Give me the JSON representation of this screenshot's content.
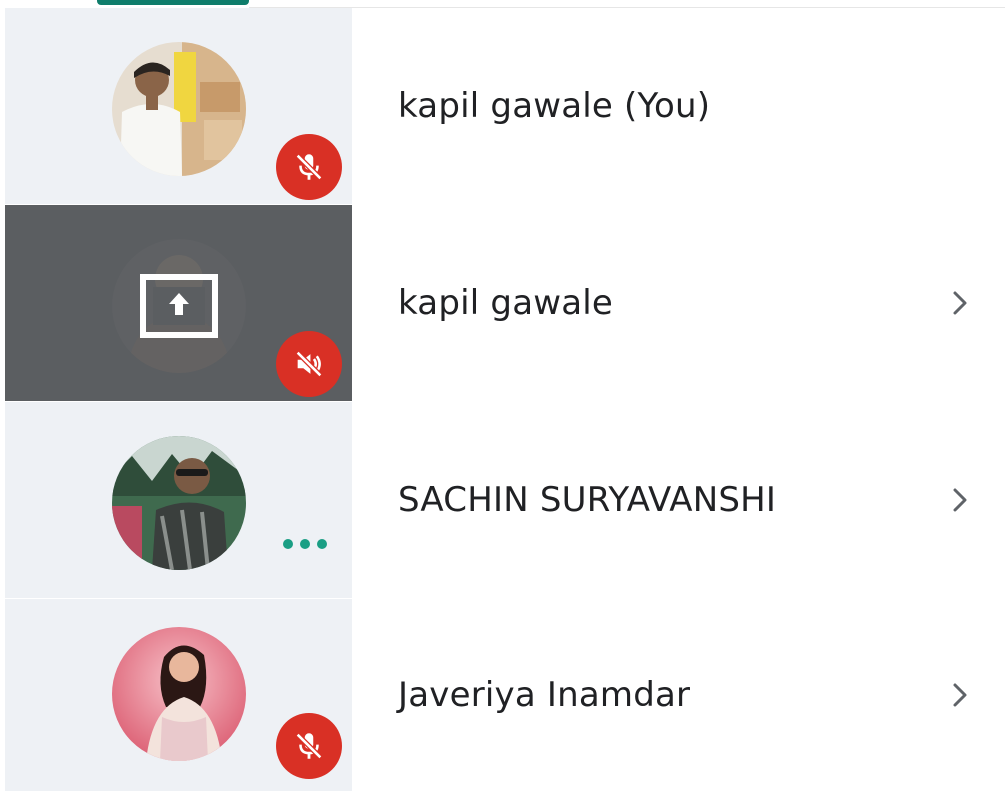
{
  "participants": [
    {
      "name": "kapil gawale (You)",
      "state": "mic-off",
      "avatar": "photo-man-warehouse",
      "has_chevron": false
    },
    {
      "name": "kapil gawale",
      "state": "presenting-muted",
      "avatar": "screen-share-icon",
      "has_chevron": true
    },
    {
      "name": "SACHIN SURYAVANSHI",
      "state": "speaking",
      "avatar": "photo-man-sunglasses",
      "has_chevron": true
    },
    {
      "name": "Javeriya Inamdar",
      "state": "mic-off",
      "avatar": "photo-woman-pink",
      "has_chevron": true
    }
  ],
  "colors": {
    "accent": "#0f7d6b",
    "mute_red": "#d93025",
    "speaking_green": "#1a9e84",
    "tile_bg": "#eef1f5",
    "presenting_bg": "#5b5e61"
  }
}
